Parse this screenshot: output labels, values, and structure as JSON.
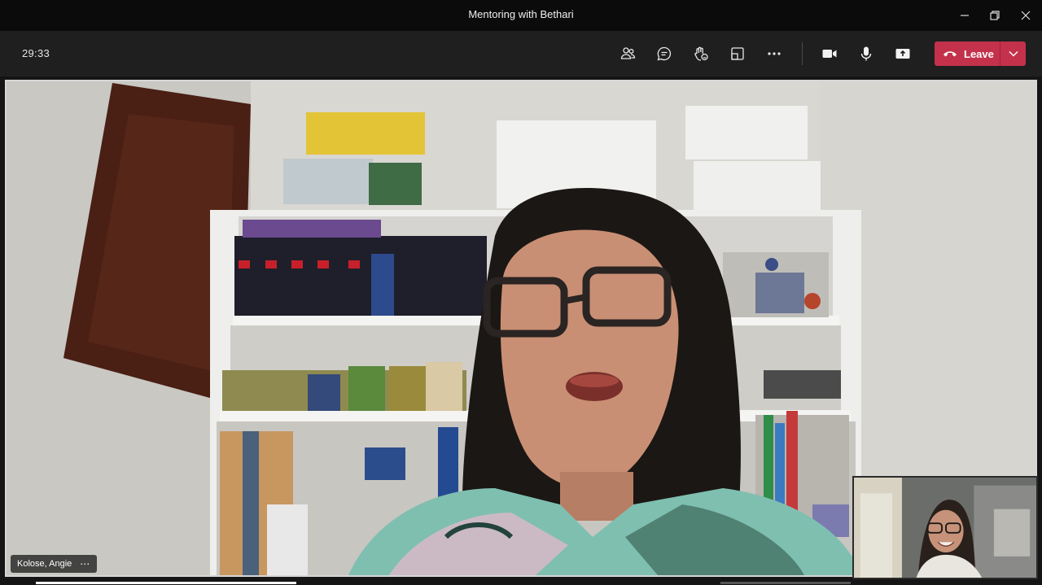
{
  "window": {
    "title": "Mentoring with Bethari",
    "controls": [
      "minimize-icon",
      "restore-icon",
      "close-icon"
    ]
  },
  "toolbar": {
    "timer": "29:33",
    "buttons": [
      {
        "name": "participants",
        "icon": "people-icon"
      },
      {
        "name": "chat",
        "icon": "chat-icon"
      },
      {
        "name": "raise-hand",
        "icon": "hand-icon"
      },
      {
        "name": "rooms",
        "icon": "breakout-icon"
      },
      {
        "name": "more-actions",
        "icon": "ellipsis-icon"
      },
      {
        "name": "camera",
        "icon": "camera-icon"
      },
      {
        "name": "microphone",
        "icon": "mic-icon"
      },
      {
        "name": "share",
        "icon": "share-tray-icon"
      }
    ],
    "leave_label": "Leave",
    "leave_color": "#c4314b"
  },
  "main_video": {
    "participant_name": "Kolose, Angie",
    "more_label": "⋯"
  },
  "self_view": {
    "label": "self preview"
  }
}
